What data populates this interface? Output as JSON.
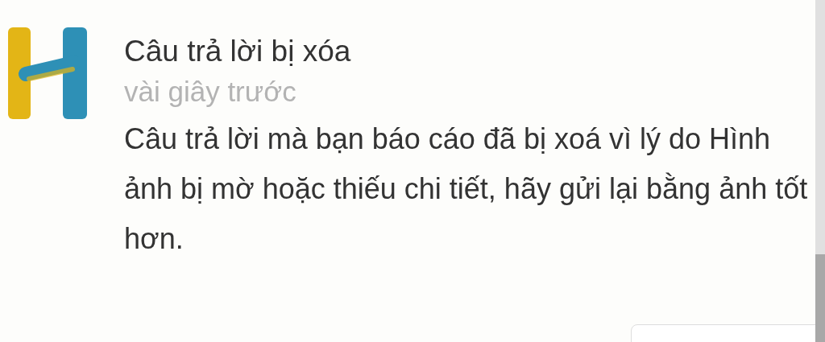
{
  "notification": {
    "title": "Câu trả lời bị xóa",
    "time": "vài giây trước",
    "message": "Câu trả lời mà bạn báo cáo đã bị xoá vì lý do Hình ảnh bị mờ hoặc thiếu chi tiết, hãy gửi lại bằng ảnh tốt hơn."
  }
}
